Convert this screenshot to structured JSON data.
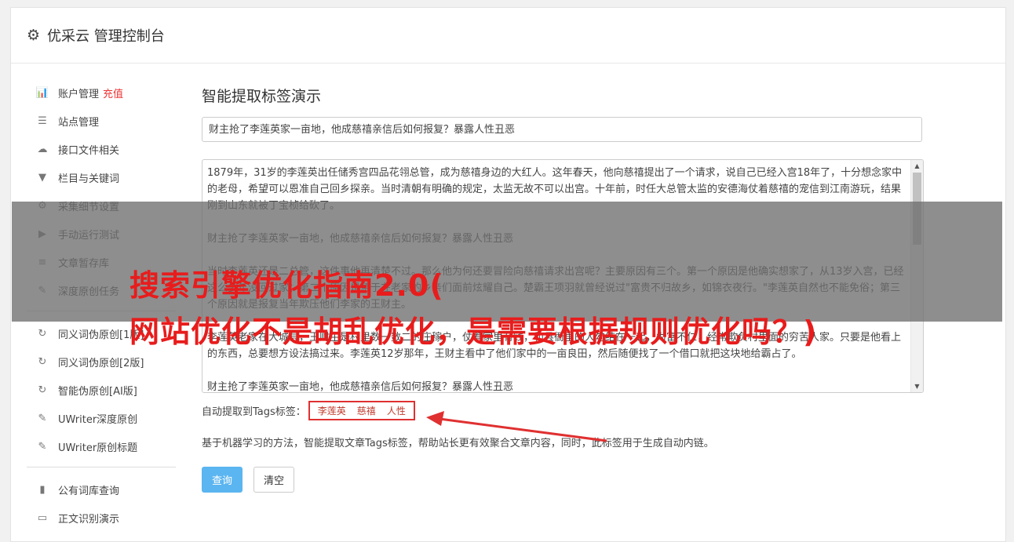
{
  "header": {
    "title": "优采云 管理控制台",
    "icon": "gear-icon"
  },
  "sidebar": {
    "items": [
      {
        "label": "账户管理",
        "badge": "充值",
        "icon": "bar-chart-icon",
        "glyph": "📊"
      },
      {
        "label": "站点管理",
        "icon": "server-icon",
        "glyph": "☰"
      },
      {
        "label": "接口文件相关",
        "icon": "cloud-upload-icon",
        "glyph": "☁"
      },
      {
        "label": "栏目与关键词",
        "icon": "filter-icon",
        "glyph": "▼"
      },
      {
        "label": "采集细节设置",
        "icon": "cogs-icon",
        "glyph": "⚙"
      },
      {
        "label": "手动运行测试",
        "icon": "play-circle-icon",
        "glyph": "▶"
      },
      {
        "label": "文章暂存库",
        "icon": "database-icon",
        "glyph": "≡"
      },
      {
        "label": "深度原创任务",
        "icon": "edit-icon",
        "glyph": "✎"
      }
    ],
    "items2": [
      {
        "label": "同义词伪原创[1版]",
        "icon": "refresh-icon",
        "glyph": "↻"
      },
      {
        "label": "同义词伪原创[2版]",
        "icon": "refresh-icon",
        "glyph": "↻"
      },
      {
        "label": "智能伪原创[AI版]",
        "icon": "refresh-icon",
        "glyph": "↻"
      },
      {
        "label": "UWriter深度原创",
        "icon": "edit-icon",
        "glyph": "✎"
      },
      {
        "label": "UWriter原创标题",
        "icon": "edit-icon",
        "glyph": "✎"
      }
    ],
    "items3": [
      {
        "label": "公有词库查询",
        "icon": "book-icon",
        "glyph": "▮"
      },
      {
        "label": "正文识别演示",
        "icon": "window-icon",
        "glyph": "▭"
      }
    ]
  },
  "main": {
    "heading": "智能提取标签演示",
    "title_value": "财主抢了李莲英家一亩地，他成慈禧亲信后如何报复？暴露人性丑恶",
    "content": "1879年，31岁的李莲英出任储秀宫四品花翎总管，成为慈禧身边的大红人。这年春天，他向慈禧提出了一个请求，说自己已经入宫18年了，十分想念家中的老母，希望可以恩准自己回乡探亲。当时清朝有明确的规定，太监无故不可以出宫。十年前，时任大总管太监的安德海仗着慈禧的宠信到江南游玩，结果刚到山东就被丁宝桢给砍了。\n\n财主抢了李莲英家一亩地，他成慈禧亲信后如何报复？暴露人性丑恶\n\n当时李莲英还是二总管，这件事他再清楚不过。那么他为何还要冒险向慈禧请求出宫呢？主要原因有三个。第一个原因是他确实想家了，从13岁入宫，已经这么多年没回过家；第二个原因是急于在老家的乡亲们面前炫耀自己。楚霸王项羽就曾经说过\"富贵不归故乡，如锦衣夜行。\"李莲英自然也不能免俗；第三个原因就是报复当年欺压他们李家的王财主。\n\n李莲英老家在大城县，王财主是村里数一数二的庄稼户，仗着家里有钱，和县衙里的人勾结在一起，为富不仁，经常欺负村里面的穷苦人家。只要是他看上的东西，总要想方设法搞过来。李莲英12岁那年，王财主看中了他们家中的一亩良田，然后随便找了一个借口就把这块地给霸占了。\n\n财主抢了李莲英家一亩地，他成慈禧亲信后如何报复？暴露人性丑恶",
    "tags_label": "自动提取到Tags标签：",
    "tags": [
      "李莲英",
      "慈禧",
      "人性"
    ],
    "description": "基于机器学习的方法，智能提取文章Tags标签，帮助站长更有效聚合文章内容，同时，此标签用于生成自动内链。",
    "query_button": "查询",
    "clear_button": "清空"
  },
  "overlay": {
    "line1": "搜索引擎优化指南2.0(",
    "line2": "网站优化不是胡乱优化，是需要根据规则优化吗？)"
  },
  "colors": {
    "accent": "#5bb5f0",
    "highlight": "#e03030",
    "overlay_text": "#e81c1c"
  }
}
